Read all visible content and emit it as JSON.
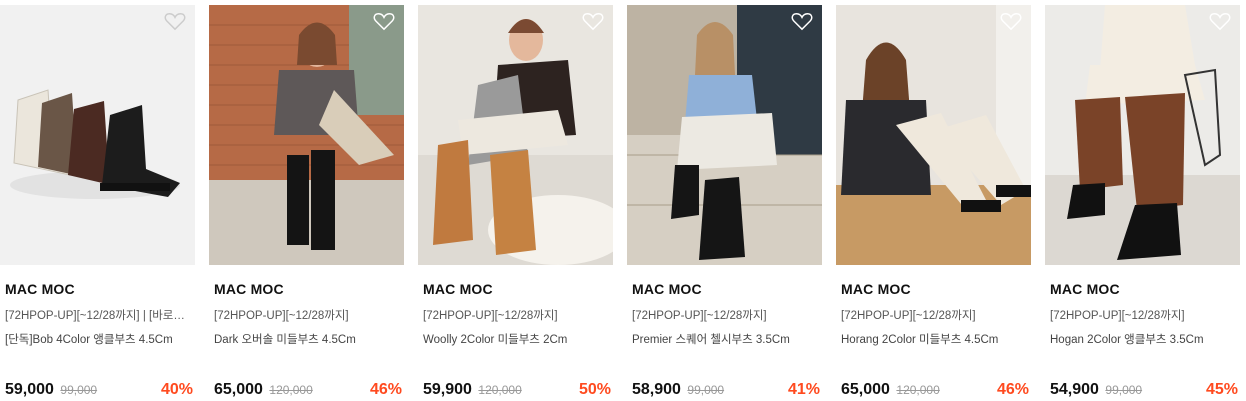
{
  "products": [
    {
      "brand": "MAC MOC",
      "promo": "[72HPOP-UP][~12/28까지] | [바로…",
      "title": "[단독]Bob 4Color 앵클부츠 4.5Cm",
      "price": "59,000",
      "original_price": "99,000",
      "discount": "40%",
      "image": "four-ankle-boots-product"
    },
    {
      "brand": "MAC MOC",
      "promo": "[72HPOP-UP][~12/28까지]",
      "title": "Dark 오버솔 미들부츠 4.5Cm",
      "price": "65,000",
      "original_price": "120,000",
      "discount": "46%",
      "image": "model-brick-wall-black-boots"
    },
    {
      "brand": "MAC MOC",
      "promo": "[72HPOP-UP][~12/28까지]",
      "title": "Woolly 2Color 미들부츠 2Cm",
      "price": "59,900",
      "original_price": "120,000",
      "discount": "50%",
      "image": "model-camel-shearling-boots"
    },
    {
      "brand": "MAC MOC",
      "promo": "[72HPOP-UP][~12/28까지]",
      "title": "Premier 스퀘어 첼시부츠 3.5Cm",
      "price": "58,900",
      "original_price": "99,000",
      "discount": "41%",
      "image": "model-steps-chelsea-boots"
    },
    {
      "brand": "MAC MOC",
      "promo": "[72HPOP-UP][~12/28까지]",
      "title": "Horang 2Color 미들부츠 4.5Cm",
      "price": "65,000",
      "original_price": "120,000",
      "discount": "46%",
      "image": "model-ivory-middle-boots"
    },
    {
      "brand": "MAC MOC",
      "promo": "[72HPOP-UP][~12/28까지]",
      "title": "Hogan 2Color 앵클부츠 3.5Cm",
      "price": "54,900",
      "original_price": "99,000",
      "discount": "45%",
      "image": "model-brown-pants-ankle-boots"
    }
  ],
  "colors": {
    "discount": "#ff4a1f",
    "text": "#111111",
    "muted": "#999999"
  },
  "icons": {
    "wishlist": "heart-outline-icon"
  }
}
